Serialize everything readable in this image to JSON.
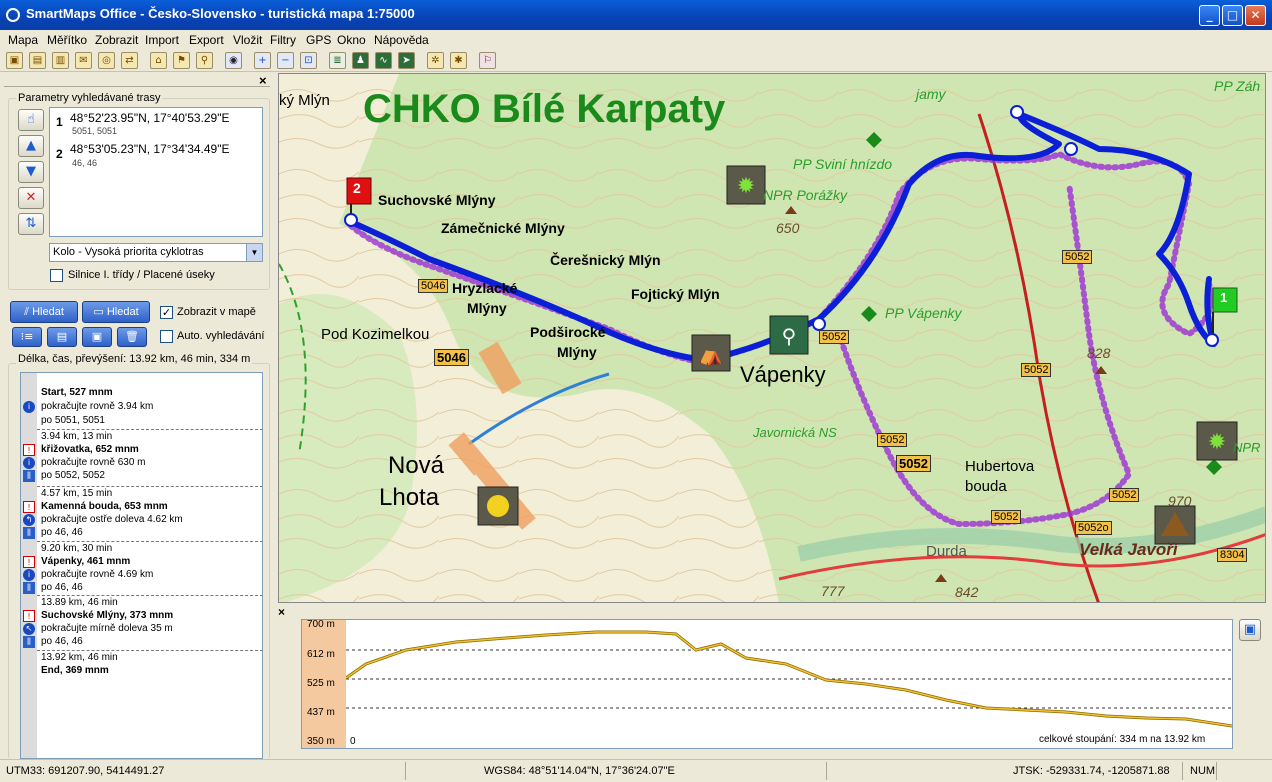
{
  "window": {
    "title": "SmartMaps Office - Česko-Slovensko - turistická mapa 1:75000",
    "min": "_",
    "max": "□",
    "close": "✕"
  },
  "menu": [
    "Mapa",
    "Měřítko",
    "Zobrazit",
    "Import",
    "Export",
    "Vložit",
    "Filtry",
    "GPS",
    "Okno",
    "Nápověda"
  ],
  "panel": {
    "close": "×",
    "params_title": "Parametry vyhledávané trasy",
    "waypoints": [
      {
        "num": "1",
        "coords": "48°52'23.95\"N, 17°40'53.29\"E",
        "sub": "5051, 5051"
      },
      {
        "num": "2",
        "coords": "48°53'05.23\"N, 17°34'34.49\"E",
        "sub": "46, 46"
      }
    ],
    "mode": "Kolo - Vysoká priorita cyklotras",
    "roads_check": "Silnice I. třídy / Placené úseky",
    "search1": "Hledat",
    "search2": "Hledat",
    "show_in_map": "Zobrazit v mapě",
    "auto_search": "Auto. vyhledávání",
    "summary": "Délka, čas, převýšení: 13.92 km, 46 min, 334 m",
    "itinerary": [
      {
        "type": "start",
        "title": "Start, 527 mnm",
        "lines": [
          "pokračujte rovně 3.94 km",
          "po 5051, 5051"
        ]
      },
      {
        "type": "warn",
        "dist": "3.94 km, 13 min",
        "title": "křižovatka, 652 mnm",
        "lines": [
          "pokračujte rovně 630 m",
          "po 5052, 5052"
        ]
      },
      {
        "type": "warn",
        "dist": "4.57 km, 15 min",
        "title": "Kamenná bouda, 653 mnm",
        "lines": [
          "pokračujte ostře doleva 4.62 km",
          "po 46, 46"
        ]
      },
      {
        "type": "warn",
        "dist": "9.20 km, 30 min",
        "title": "Vápenky, 461 mnm",
        "lines": [
          "pokračujte rovně 4.69 km",
          "po 46, 46"
        ]
      },
      {
        "type": "warn",
        "dist": "13.89 km, 46 min",
        "title": "Suchovské Mlýny, 373 mnm",
        "lines": [
          "pokračujte mírně doleva 35 m",
          "po 46, 46"
        ]
      },
      {
        "type": "end",
        "dist": "13.92 km, 46 min",
        "title": "End, 369 mnm",
        "lines": []
      }
    ]
  },
  "map": {
    "title": "CHKO Bílé Karpaty",
    "labels": {
      "suchovske": "Suchovské Mlýny",
      "zamecnicke": "Zámečnické Mlýny",
      "cerenicky": "Čerešnický Mlýn",
      "hryzlacke": "Hryzlacké",
      "hryzlacke2": "Mlýny",
      "fojticky": "Fojtický Mlýn",
      "podsirocke": "Podširocké",
      "podsirocke2": "Mlýny",
      "pod_kozimelkou": "Pod Kozimelkou",
      "vapenky": "Vápenky",
      "nova": "Nová",
      "lhota": "Lhota",
      "hubertova": "Hubertova",
      "bouda": "bouda",
      "velka_javori": "Velká Javoří",
      "durda": "Durda",
      "javornicka": "Javornická NS",
      "pp_vapenky": "PP Vápenky",
      "pp_svini": "PP Sviní hnízdo",
      "npr_porazky": "NPR Porážky",
      "pp_zah": "PP Záh",
      "npr": "NPR",
      "jamy": "jamy",
      "kym": "ký Mlýn",
      "h650": "650",
      "h828": "828",
      "h970": "970",
      "h777": "777",
      "h842": "842",
      "r5046": "5046",
      "r5046b": "5046",
      "r5052a": "5052",
      "r5052b": "5052",
      "r5052c": "5052",
      "r5052d": "5052",
      "r5052e": "5052",
      "r5052f": "5052",
      "r5052g": "5052o",
      "r8304": "8304",
      "marker1": "1",
      "marker2": "2"
    }
  },
  "profile": {
    "close": "×",
    "y_ticks": [
      "700 m",
      "612 m",
      "525 m",
      "437 m",
      "350 m"
    ],
    "x_zero": "0",
    "summary": "celkové stoupání: 334 m na 13.92 km"
  },
  "status": {
    "utm": "UTM33: 691207.90, 5414491.27",
    "wgs": "WGS84: 48°51'14.04\"N, 17°36'24.07\"E",
    "jtsk": "JTSK: -529331.74, -1205871.88",
    "num": "NUM"
  },
  "colors": {
    "route": "#0b1fd6",
    "title_green": "#1a8a1a",
    "path_purple": "#9b2fd4"
  }
}
